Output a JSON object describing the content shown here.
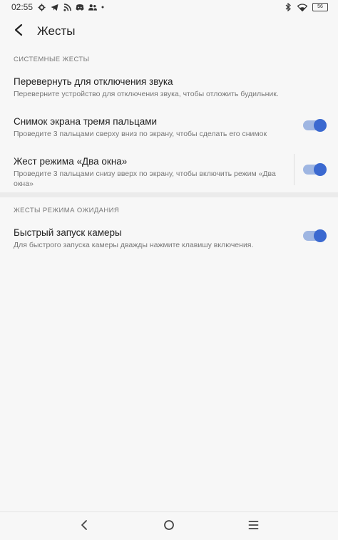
{
  "status_bar": {
    "time": "02:55",
    "battery": "56",
    "left_icons": [
      "gear-icon",
      "telegram-icon",
      "rss-icon",
      "discord-icon",
      "people-icon",
      "dot-icon"
    ],
    "right_icons": [
      "bluetooth-icon",
      "wifi-icon",
      "battery-icon"
    ]
  },
  "header": {
    "title": "Жесты"
  },
  "sections": [
    {
      "header": "СИСТЕМНЫЕ ЖЕСТЫ",
      "items": [
        {
          "title": "Перевернуть для отключения звука",
          "subtitle": "Переверните устройство для отключения звука, чтобы отложить будильник.",
          "toggle": null
        },
        {
          "title": "Снимок экрана тремя пальцами",
          "subtitle": "Проведите 3 пальцами сверху вниз по экрану, чтобы сделать его снимок",
          "toggle": true
        },
        {
          "title": "Жест режима «Два окна»",
          "subtitle": "Проведите 3 пальцами снизу вверх по экрану, чтобы включить режим «Два окна»",
          "toggle": true
        }
      ]
    },
    {
      "header": "ЖЕСТЫ РЕЖИМА ОЖИДАНИЯ",
      "items": [
        {
          "title": "Быстрый запуск камеры",
          "subtitle": "Для быстрого запуска камеры дважды нажмите клавишу включения.",
          "toggle": true
        }
      ]
    }
  ],
  "colors": {
    "accent": "#3b69d0",
    "toggle_track": "#9fb6e2",
    "background": "#f7f7f7"
  },
  "nav_bar": {
    "buttons": [
      "back-icon",
      "home-icon",
      "menu-icon"
    ]
  }
}
